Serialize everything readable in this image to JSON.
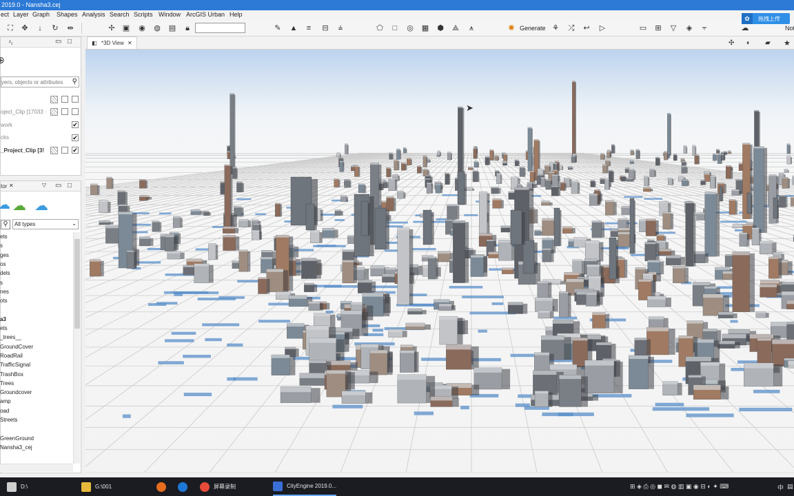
{
  "title_bar": {
    "text": "2019.0 - Nansha3.cej"
  },
  "menu": {
    "items": [
      "ect",
      "Layer",
      "Graph",
      "Shapes",
      "Analysis",
      "Search",
      "Scripts",
      "Window",
      "ArcGIS Urban",
      "Help"
    ]
  },
  "toolbar": {
    "generate_label": "Generate",
    "right_label": "Not",
    "upload_label": "拖拽上传"
  },
  "scene_panel": {
    "tab_label": "²₂",
    "search_placeholder": "yers, objects or attributes",
    "rows": [
      {
        "label": "",
        "checked_a": false,
        "checked_b": false
      },
      {
        "label": "oject_Clip [17033 ·",
        "checked_a": false,
        "checked_b": false
      },
      {
        "label": "work",
        "checked_b": true
      },
      {
        "label": "cks",
        "checked_b": true
      },
      {
        "label": "_Project_Clip [3!",
        "checked_a": false,
        "checked_b": true
      }
    ]
  },
  "navigator_panel": {
    "title": "tor",
    "type_filter": "All types",
    "items": [
      "ets",
      "s",
      "ges",
      "os",
      "dels",
      "s",
      "nes",
      "ots",
      "",
      "a3",
      "ets",
      "_trees__",
      "GroundCover",
      "RoadRail",
      "TrafficSignal",
      "TrashBox",
      "Trees",
      "Groundcover",
      "amp",
      "oad",
      "Streets",
      "",
      "GreenGround",
      "Nansha3_cej"
    ]
  },
  "view": {
    "tab_label": "*3D View"
  },
  "taskbar": {
    "items": [
      {
        "label": "D:\\",
        "color": "#d8d8d8"
      },
      {
        "label": "G:\\001",
        "color": "#e8b93a"
      },
      {
        "label": "",
        "color": "#e66c1e"
      },
      {
        "label": "",
        "color": "#1e78d6"
      },
      {
        "label": "屏幕录制",
        "color": "#e84a3a"
      },
      {
        "label": "CityEngine 2019.0...",
        "color": "#3a6fd6"
      }
    ],
    "lang": "中"
  }
}
